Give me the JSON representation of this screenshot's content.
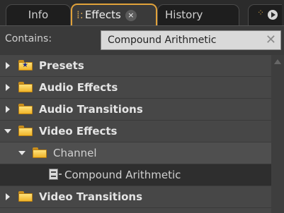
{
  "tabs": {
    "info": "Info",
    "effects": "Effects",
    "history": "History",
    "close_glyph": "×"
  },
  "search": {
    "label": "Contains:",
    "value": "Compound Arithmetic",
    "clear_glyph": "✕"
  },
  "tree": {
    "presets": "Presets",
    "audio_effects": "Audio Effects",
    "audio_transitions": "Audio Transitions",
    "video_effects": "Video Effects",
    "channel": "Channel",
    "compound_arithmetic": "Compound Arithmetic",
    "video_transitions": "Video Transitions"
  },
  "colors": {
    "accent_tab": "#e1a23a",
    "folder": "#f0b52a"
  }
}
